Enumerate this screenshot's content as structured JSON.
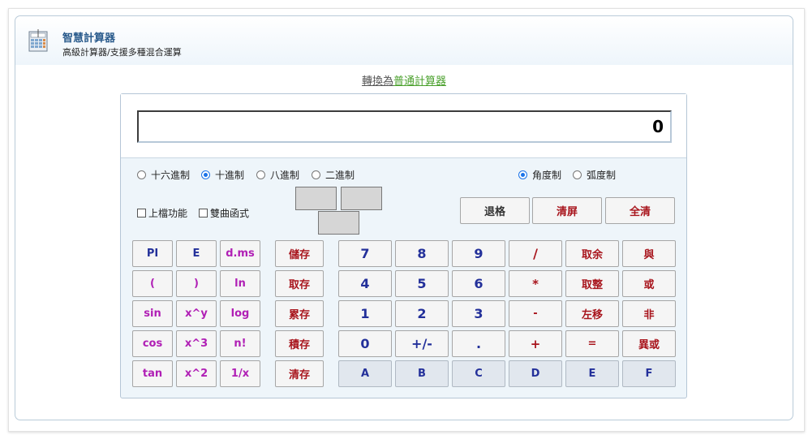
{
  "header": {
    "title": "智慧計算器",
    "subtitle": "高級計算器/支援多種混合運算"
  },
  "switch_link": {
    "prefix": "轉換為",
    "target": "普通計算器"
  },
  "display": {
    "value": "0"
  },
  "base_radios": [
    {
      "label": "十六進制",
      "selected": false
    },
    {
      "label": "十進制",
      "selected": true
    },
    {
      "label": "八進制",
      "selected": false
    },
    {
      "label": "二進制",
      "selected": false
    }
  ],
  "angle_radios": [
    {
      "label": "角度制",
      "selected": true
    },
    {
      "label": "弧度制",
      "selected": false
    }
  ],
  "checkboxes": [
    {
      "label": "上檔功能",
      "checked": false
    },
    {
      "label": "雙曲函式",
      "checked": false
    }
  ],
  "control_buttons": [
    "退格",
    "清屏",
    "全清"
  ],
  "function_buttons": [
    [
      "PI",
      "E",
      "d.ms"
    ],
    [
      "(",
      ")",
      "ln"
    ],
    [
      "sin",
      "x^y",
      "log"
    ],
    [
      "cos",
      "x^3",
      "n!"
    ],
    [
      "tan",
      "x^2",
      "1/x"
    ]
  ],
  "memory_buttons": [
    "儲存",
    "取存",
    "累存",
    "積存",
    "清存"
  ],
  "keypad": [
    [
      "7",
      "8",
      "9",
      "/",
      "取余",
      "與"
    ],
    [
      "4",
      "5",
      "6",
      "*",
      "取整",
      "或"
    ],
    [
      "1",
      "2",
      "3",
      "-",
      "左移",
      "非"
    ],
    [
      "0",
      "+/-",
      ".",
      "+",
      "=",
      "異或"
    ],
    [
      "A",
      "B",
      "C",
      "D",
      "E",
      "F"
    ]
  ],
  "colors": {
    "function_text": "#b01fb5",
    "digit_text": "#23309a",
    "operator_text": "#a8141c"
  }
}
